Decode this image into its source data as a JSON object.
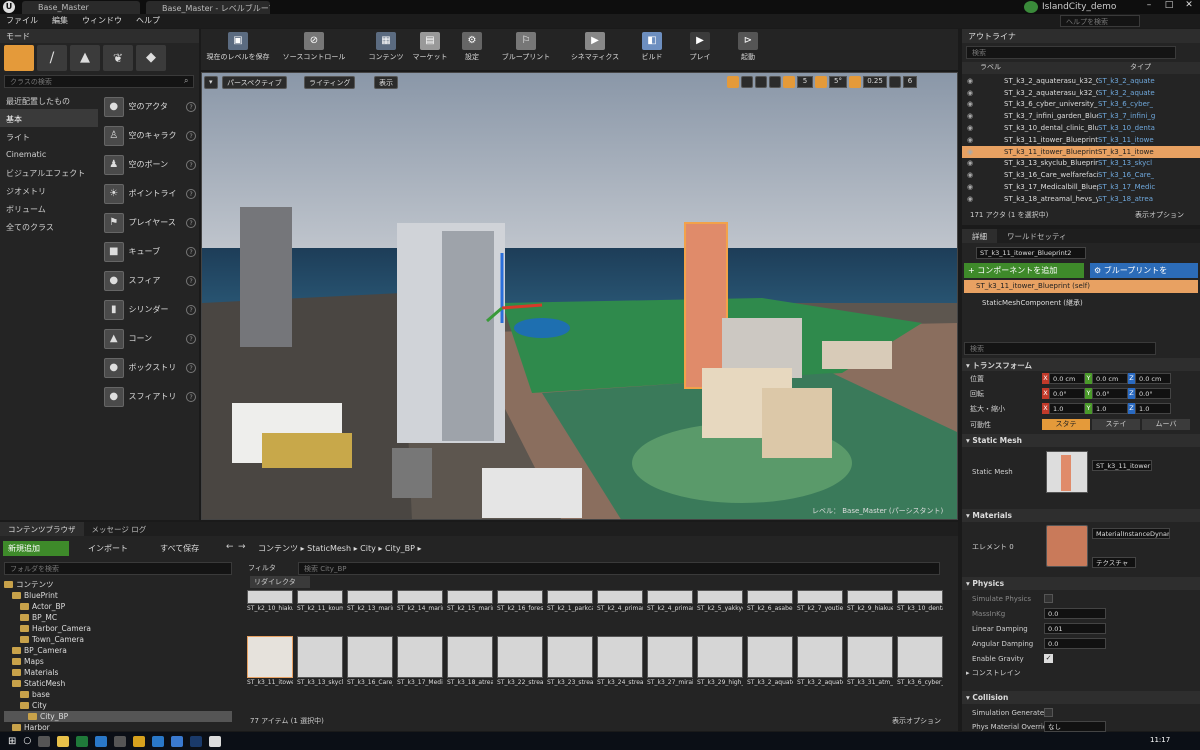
{
  "window": {
    "tabs": [
      "Base_Master",
      "Base_Master - レベルブループリント"
    ],
    "project_name": "IslandCity_demo",
    "help_search_placeholder": "ヘルプを検索"
  },
  "menu": [
    "ファイル",
    "編集",
    "ウィンドウ",
    "ヘルプ"
  ],
  "modes_panel": {
    "title": "モード",
    "search_placeholder": "クラスの検索",
    "categories": [
      "最近配置したもの",
      "基本",
      "ライト",
      "Cinematic",
      "ビジュアルエフェクト",
      "ジオメトリ",
      "ボリューム",
      "全てのクラス"
    ],
    "selected_category": "基本",
    "actors": [
      "空のアクタ",
      "空のキャラク",
      "空のポーン",
      "ポイントライ",
      "プレイヤース",
      "キューブ",
      "スフィア",
      "シリンダー",
      "コーン",
      "ボックストリ",
      "スフィアトリ"
    ]
  },
  "toolbar": [
    {
      "label": "現在のレベルを保存",
      "icon": "save-icon"
    },
    {
      "label": "ソースコントロール",
      "icon": "source-control-icon"
    },
    {
      "label": "コンテンツ",
      "icon": "content-icon"
    },
    {
      "label": "マーケット",
      "icon": "marketplace-icon"
    },
    {
      "label": "設定",
      "icon": "settings-icon"
    },
    {
      "label": "ブループリント",
      "icon": "blueprint-icon"
    },
    {
      "label": "シネマティクス",
      "icon": "cinematics-icon"
    },
    {
      "label": "ビルド",
      "icon": "build-icon"
    },
    {
      "label": "プレイ",
      "icon": "play-icon"
    },
    {
      "label": "起動",
      "icon": "launch-icon"
    }
  ],
  "viewport": {
    "perspective": "パースペクティブ",
    "lighting": "ライティング",
    "show": "表示",
    "grid_snap": "5",
    "rotation_snap": "5°",
    "scale_snap": "0.25",
    "camera_speed": "6",
    "level_label": "レベル： Base_Master (パーシスタント)"
  },
  "outliner": {
    "title": "アウトライナ",
    "search_placeholder": "検索",
    "col_label": "ラベル",
    "col_type": "タイプ",
    "rows": [
      {
        "name": "ST_k3_2_aquaterasu_k32_01_Blueprint",
        "type": "ST_k3_2_aquate"
      },
      {
        "name": "ST_k3_2_aquaterasu_k32_02_Blueprint",
        "type": "ST_k3_2_aquate"
      },
      {
        "name": "ST_k3_6_cyber_university_Blueprint",
        "type": "ST_k3_6_cyber_"
      },
      {
        "name": "ST_k3_7_infini_garden_Blueprint",
        "type": "ST_k3_7_infini_g"
      },
      {
        "name": "ST_k3_10_dental_clinic_Blueprint",
        "type": "ST_k3_10_denta"
      },
      {
        "name": "ST_k3_11_itower_Blueprint",
        "type": "ST_k3_11_itowe"
      },
      {
        "name": "ST_k3_11_itower_Blueprint2",
        "type": "ST_k3_11_itowe"
      },
      {
        "name": "ST_k3_13_skyclub_Blueprint",
        "type": "ST_k3_13_skycl"
      },
      {
        "name": "ST_k3_16_Care_welfarefacility_Blue",
        "type": "ST_k3_16_Care_"
      },
      {
        "name": "ST_k3_17_Medicalbill_Blueprint",
        "type": "ST_k3_17_Medic"
      },
      {
        "name": "ST_k3_18_atreamal_hevs_yakiniku",
        "type": "ST_k3_18_atrea"
      }
    ],
    "selected_index": 6,
    "footer": "171 アクタ (1 を選択中)",
    "view_options": "表示オプション"
  },
  "details": {
    "tabs": [
      "詳細",
      "ワールドセッティ"
    ],
    "object_name": "ST_k3_11_itower_Blueprint2",
    "add_component": "+ コンポーネントを追加",
    "blueprint_button": "ブループリントを",
    "self_component": "ST_k3_11_itower_Blueprint (self)",
    "static_mesh_component": "StaticMeshComponent (継承)",
    "search_placeholder": "検索",
    "transform": {
      "title": "トランスフォーム",
      "location_label": "位置",
      "location": [
        "0.0 cm",
        "0.0 cm",
        "0.0 cm"
      ],
      "rotation_label": "回転",
      "rotation": [
        "0.0°",
        "0.0°",
        "0.0°"
      ],
      "scale_label": "拡大・縮小",
      "scale": [
        "1.0",
        "1.0",
        "1.0"
      ],
      "mobility_label": "可動性",
      "mobility": [
        "スタテ",
        "ステイ",
        "ムーバ"
      ]
    },
    "static_mesh": {
      "title": "Static Mesh",
      "label": "Static Mesh",
      "value": "ST_k3_11_itower"
    },
    "materials": {
      "title": "Materials",
      "element_label": "エレメント 0",
      "value": "MaterialInstanceDynami",
      "texture": "テクスチャ"
    },
    "physics": {
      "title": "Physics",
      "simulate": "Simulate Physics",
      "mass": "MassInKg",
      "mass_value": "0.0",
      "linear_damping": "Linear Damping",
      "linear_value": "0.01",
      "angular_damping": "Angular Damping",
      "angular_value": "0.0",
      "gravity": "Enable Gravity",
      "constraints": "コンストレイン"
    },
    "collision": {
      "title": "Collision",
      "sim_gen": "Simulation Generates",
      "phys_override": "Phys Material Override",
      "phys_value": "なし"
    }
  },
  "content_browser": {
    "tabs": [
      "コンテンツブラウザ",
      "メッセージ ログ"
    ],
    "new_add": "新規追加",
    "import": "インポート",
    "save_all": "すべて保存",
    "breadcrumb": [
      "コンテンツ",
      "StaticMesh",
      "City",
      "City_BP"
    ],
    "folder_search_placeholder": "フォルダを検索",
    "filter": "フィルタ",
    "asset_search_placeholder": "検索 City_BP",
    "collection": "リダイレクタ",
    "tree": [
      {
        "label": "コンテンツ",
        "depth": 0
      },
      {
        "label": "BluePrint",
        "depth": 1
      },
      {
        "label": "Actor_BP",
        "depth": 2
      },
      {
        "label": "BP_MC",
        "depth": 2
      },
      {
        "label": "Harbor_Camera",
        "depth": 2
      },
      {
        "label": "Town_Camera",
        "depth": 2
      },
      {
        "label": "BP_Camera",
        "depth": 1
      },
      {
        "label": "Maps",
        "depth": 1
      },
      {
        "label": "Materials",
        "depth": 1
      },
      {
        "label": "StaticMesh",
        "depth": 1
      },
      {
        "label": "base",
        "depth": 2
      },
      {
        "label": "City",
        "depth": 2
      },
      {
        "label": "City_BP",
        "depth": 3
      },
      {
        "label": "Harbor",
        "depth": 1
      },
      {
        "label": "Ocean",
        "depth": 1
      }
    ],
    "assets_row1": [
      "ST_k2_10_hiakuen2_Blueprint",
      "ST_k2_11_kouminnkann_Blueprint",
      "ST_k2_13_marinacourt1_Blueprint",
      "ST_k2_14_marinacourt2_Blueprint",
      "ST_k2_15_marinacourt3_Blueprint",
      "ST_k2_16_forestcasa_Blueprint",
      "ST_k2_1_parkcasa1_Blueprint",
      "ST_k2_4_primary_school01_Blueprint",
      "ST_k2_4_primary_school02_Blueprint",
      "ST_k2_5_yakkyoku_Blueprint",
      "ST_k2_6_asabeclinic_Blueprint",
      "ST_k2_7_youtien_Blueprint",
      "ST_k2_9_hiakuen1_Blueprint",
      "ST_k3_10_dental_clinic_Blueprint"
    ],
    "assets_row2": [
      "ST_k3_11_itower_Blueprint",
      "ST_k3_13_skyclub_Blueprint",
      "ST_k3_16_Care_welfarefacility_Blueprint",
      "ST_k3_17_Medicalbill_Blueprint",
      "ST_k3_18_atreamal_hevs_yakiniku",
      "ST_k3_22_streamall_plaza",
      "ST_k3_23_streamall_itiba",
      "ST_k3_24_streamall_cleaning",
      "ST_k3_27_mirai_clinic_Blueprint",
      "ST_k3_29_high_rehabilitation_Blueprint",
      "ST_k3_2_aquaterasu_k32_01",
      "ST_k3_2_aquaterasu_k32_02",
      "ST_k3_31_atm_fukugin_Blueprint",
      "ST_k3_6_cyber_university_Blueprint"
    ],
    "footer": "77 アイテム (1 選択中)",
    "view_options": "表示オプション"
  },
  "taskbar": {
    "time": "11:17"
  }
}
